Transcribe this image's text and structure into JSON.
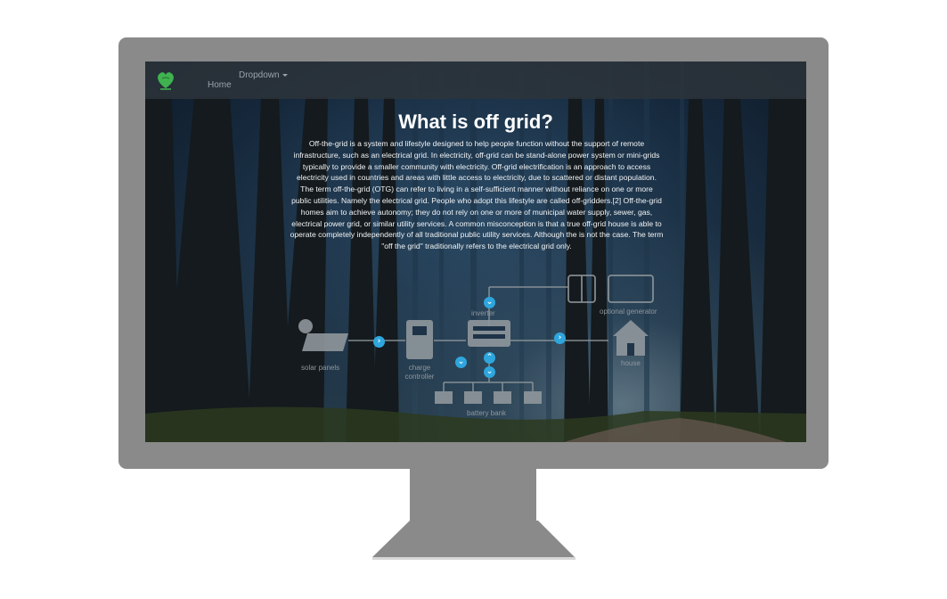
{
  "nav": {
    "logo_icon": "heart-leaf-logo",
    "home_label": "Home",
    "dropdown_label": "Dropdown"
  },
  "main": {
    "title": "What is off grid?",
    "body": "Off-the-grid is a system and lifestyle designed to help people function without the support of remote infrastructure, such as an electrical grid. In electricity, off-grid can be stand-alone power system or mini-grids typically to provide a smaller community with electricity. Off-grid electrification is an approach to access electricity used in countries and areas with little access to electricity, due to scattered or distant population. The term off-the-grid (OTG) can refer to living in a self-sufficient manner without reliance on one or more public utilities. Namely the electrical grid. People who adopt this lifestyle are called off-gridders.[2] Off-the-grid homes aim to achieve autonomy; they do not rely on one or more of municipal water supply, sewer, gas, electrical power grid, or similar utility services. A common misconception is that a true off-grid house is able to operate completely independently of all traditional public utility services. Although the is not the case. The term \"off the grid\" traditionally refers to the electrical grid only."
  },
  "diagram": {
    "labels": {
      "inverter": "inverter",
      "generator": "optional generator",
      "solar": "solar panels",
      "charge": "charge controller",
      "house": "house",
      "battery": "battery bank"
    }
  },
  "colors": {
    "arrow_accent": "#2ea6dd",
    "monitor_gray": "#8a8a8a",
    "logo_green": "#3fb34f"
  }
}
